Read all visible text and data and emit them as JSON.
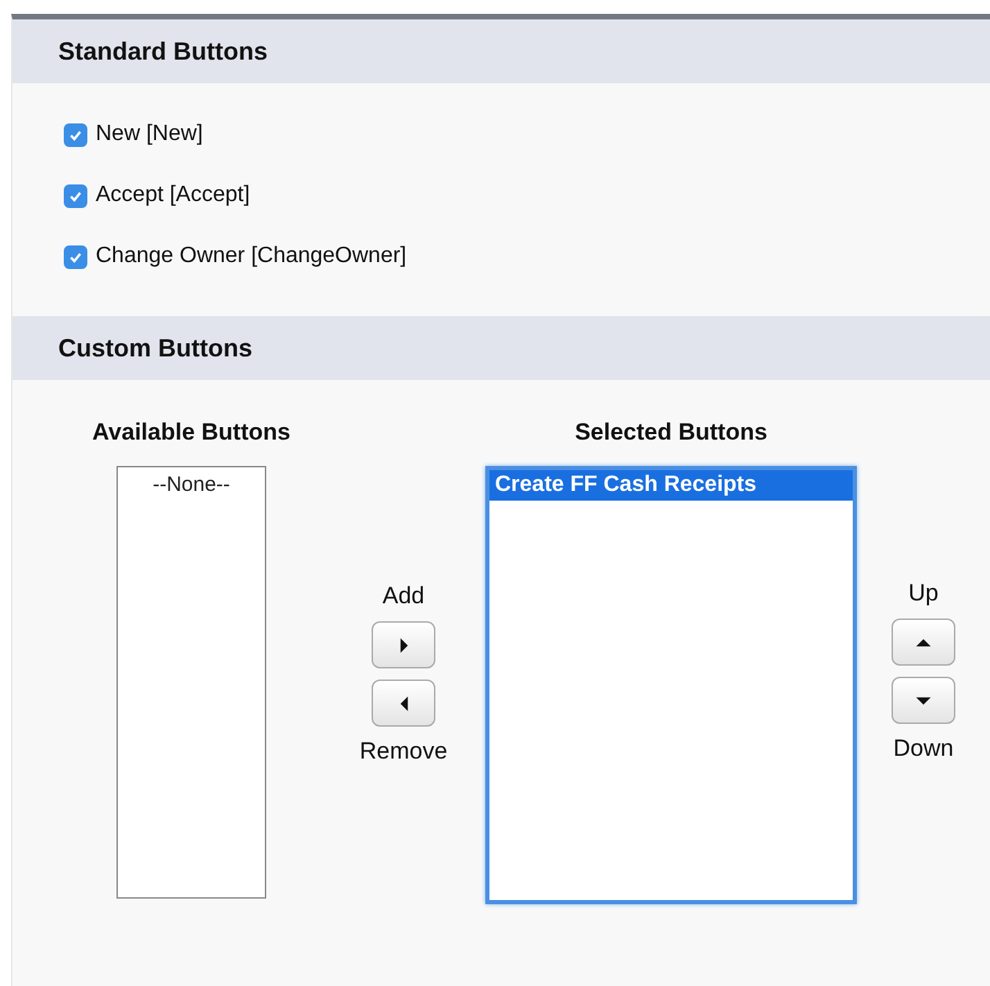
{
  "standard_buttons": {
    "title": "Standard Buttons",
    "items": [
      {
        "label": "New [New]",
        "checked": true
      },
      {
        "label": "Accept [Accept]",
        "checked": true
      },
      {
        "label": "Change Owner [ChangeOwner]",
        "checked": true
      }
    ]
  },
  "custom_buttons": {
    "title": "Custom Buttons",
    "available": {
      "label": "Available Buttons",
      "options": [
        {
          "text": "--None--",
          "selected": false
        }
      ]
    },
    "add_label": "Add",
    "remove_label": "Remove",
    "selected": {
      "label": "Selected Buttons",
      "options": [
        {
          "text": "Create FF Cash Receipts",
          "selected": true
        }
      ]
    },
    "up_label": "Up",
    "down_label": "Down"
  }
}
